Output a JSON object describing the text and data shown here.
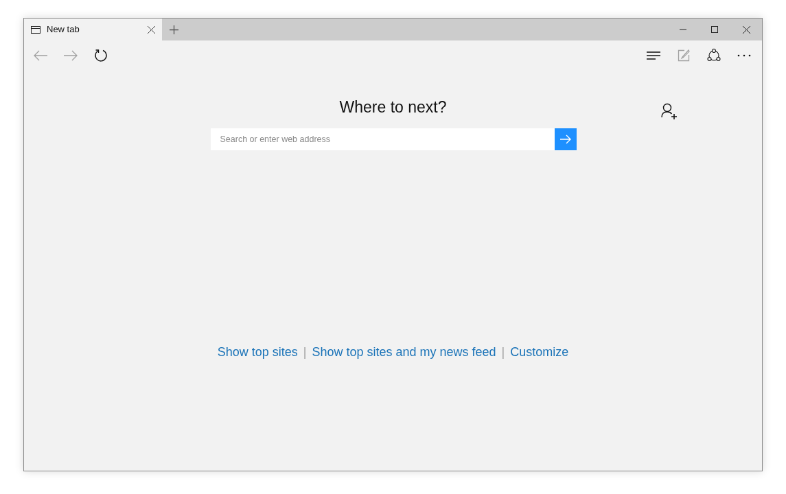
{
  "tabs": [
    {
      "title": "New tab",
      "selected": true
    }
  ],
  "nav_buttons": [
    {
      "kind": "back",
      "disabled": true
    },
    {
      "kind": "forward",
      "disabled": true
    },
    {
      "kind": "refresh",
      "disabled": false
    }
  ],
  "toolbar_buttons": [
    {
      "kind": "hub",
      "disabled": false
    },
    {
      "kind": "note",
      "disabled": true
    },
    {
      "kind": "share",
      "disabled": false
    },
    {
      "kind": "more",
      "disabled": false
    }
  ],
  "heading": "Where to next?",
  "search": {
    "placeholder": "Search or enter web address"
  },
  "links": [
    "Show top sites",
    "Show top sites and my news feed",
    "Customize"
  ],
  "separator": "|"
}
